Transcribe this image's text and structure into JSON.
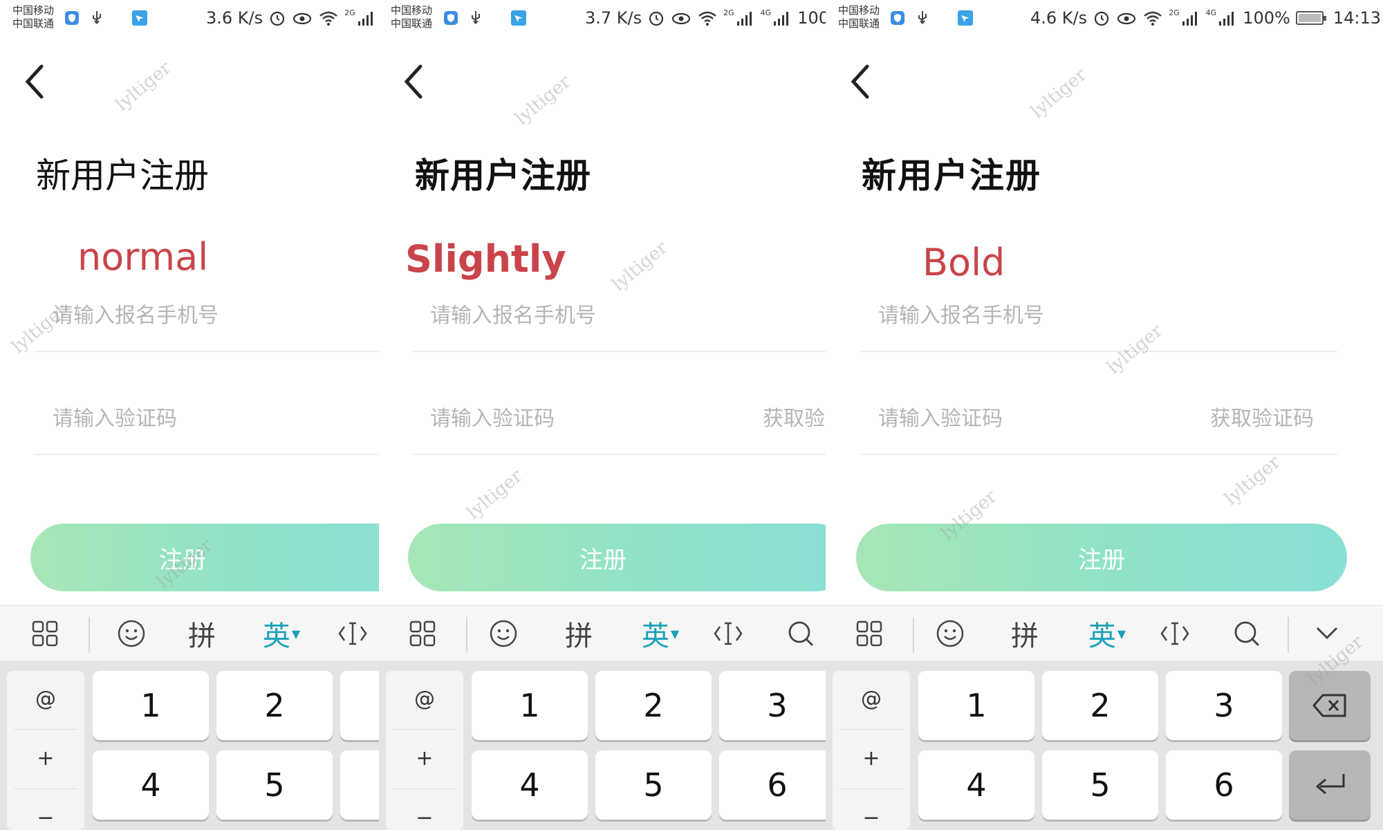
{
  "common": {
    "carrier_1": "中国移动",
    "carrier_2": "中国联通",
    "title": "新用户注册",
    "phone_placeholder": "请输入报名手机号",
    "code_placeholder": "请输入验证码",
    "get_code": "获取验证码",
    "get_code_partial": "获取验",
    "register": "注册",
    "toolbar": {
      "pinyin": "拼",
      "english": "英"
    },
    "symbols": [
      "@",
      "+",
      "−"
    ],
    "keys": [
      "1",
      "2",
      "3",
      "4",
      "5",
      "6"
    ],
    "watermark": "lyltiger",
    "sb_network_2g": "2G",
    "sb_network_4g": "4G",
    "sb_battery": "100%"
  },
  "panels": [
    {
      "label": "normal",
      "speed": "3.6 K/s"
    },
    {
      "label": "Slightly",
      "speed": "3.7 K/s"
    },
    {
      "label": "Bold",
      "speed": "4.6 K/s",
      "time": "14:13"
    }
  ],
  "colors": {
    "label": "#c9444a",
    "accent": "#1aa2b8",
    "button_start": "#a7e6b6",
    "button_end": "#8adfd6"
  },
  "icons": [
    "shield-icon",
    "usb-icon",
    "location-icon",
    "alarm-icon",
    "eye-icon",
    "wifi-icon",
    "signal-icon",
    "battery-icon",
    "back-arrow-icon",
    "grid-icon",
    "emoji-icon",
    "cursor-icon",
    "search-icon",
    "collapse-icon",
    "backspace-icon",
    "enter-icon"
  ]
}
